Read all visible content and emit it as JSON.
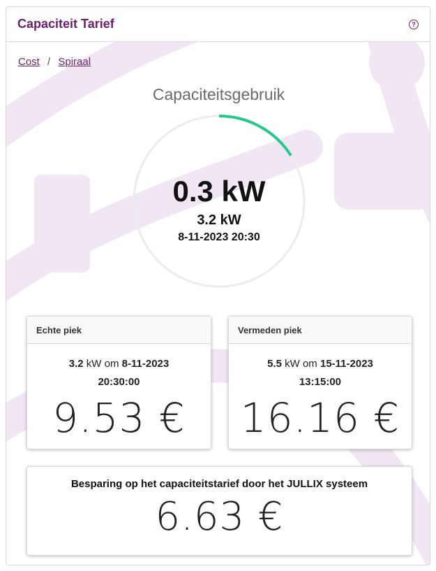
{
  "header": {
    "title": "Capaciteit Tarief",
    "help_icon": "question-circle-icon"
  },
  "breadcrumb": [
    {
      "label": "Cost"
    },
    {
      "label": "Spiraal"
    }
  ],
  "breadcrumb_separator": "/",
  "gauge": {
    "title": "Capaciteitsgebruik",
    "current": "0.3 kW",
    "peak": "3.2 kW",
    "peak_time": "8-11-2023 20:30",
    "fill_fraction": 0.16,
    "accent_color": "#22c98a"
  },
  "echte_piek": {
    "title": "Echte piek",
    "kw": "3.2",
    "unit": "kW",
    "om": "om",
    "date": "8-11-2023",
    "time": "20:30:00",
    "cost": "9.53 €"
  },
  "vermeden_piek": {
    "title": "Vermeden piek",
    "kw": "5.5",
    "unit": "kW",
    "om": "om",
    "date": "15-11-2023",
    "time": "13:15:00",
    "cost": "16.16 €"
  },
  "savings": {
    "title": "Besparing op het capaciteitstarief door het JULLIX systeem",
    "value": "6.63 €"
  },
  "colors": {
    "brand": "#6b1f6e",
    "decoration": "#f1e6f3"
  }
}
